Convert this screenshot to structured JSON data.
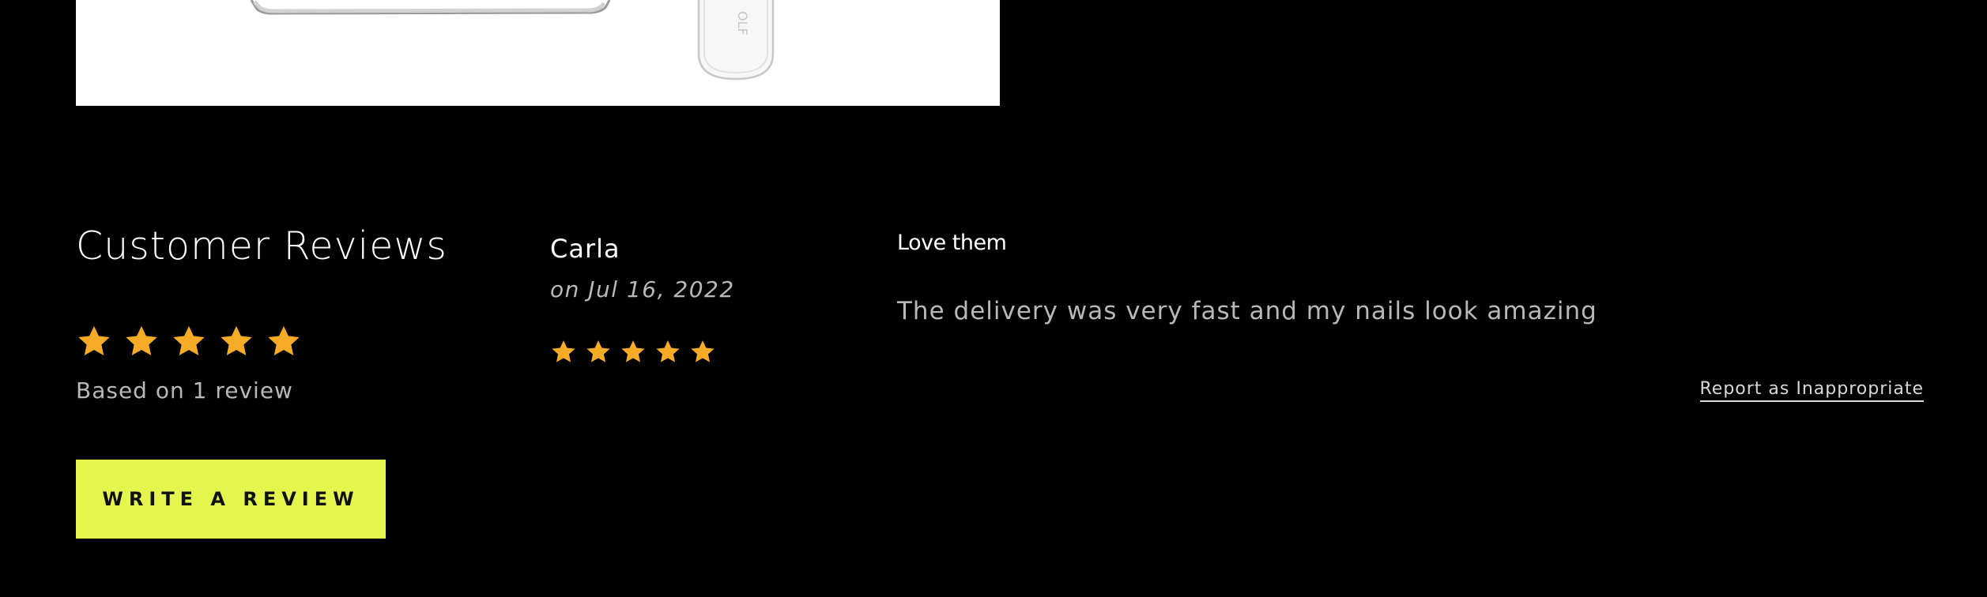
{
  "product_image": {
    "alt_icon": "nail-file-product-image",
    "background": "#ffffff"
  },
  "reviews": {
    "title": "Customer Reviews",
    "average_rating": 5,
    "max_rating": 5,
    "based_on": "Based on 1 review",
    "write_review_label": "WRITE A REVIEW",
    "star_color": "#f5ab25",
    "button_color": "#e4f54d"
  },
  "review_items": [
    {
      "reviewer": "Carla",
      "date": "on Jul 16, 2022",
      "rating": 5,
      "title": "Love them",
      "body": "The delivery was very fast and my nails look amazing",
      "report_label": "Report as Inappropriate"
    }
  ]
}
